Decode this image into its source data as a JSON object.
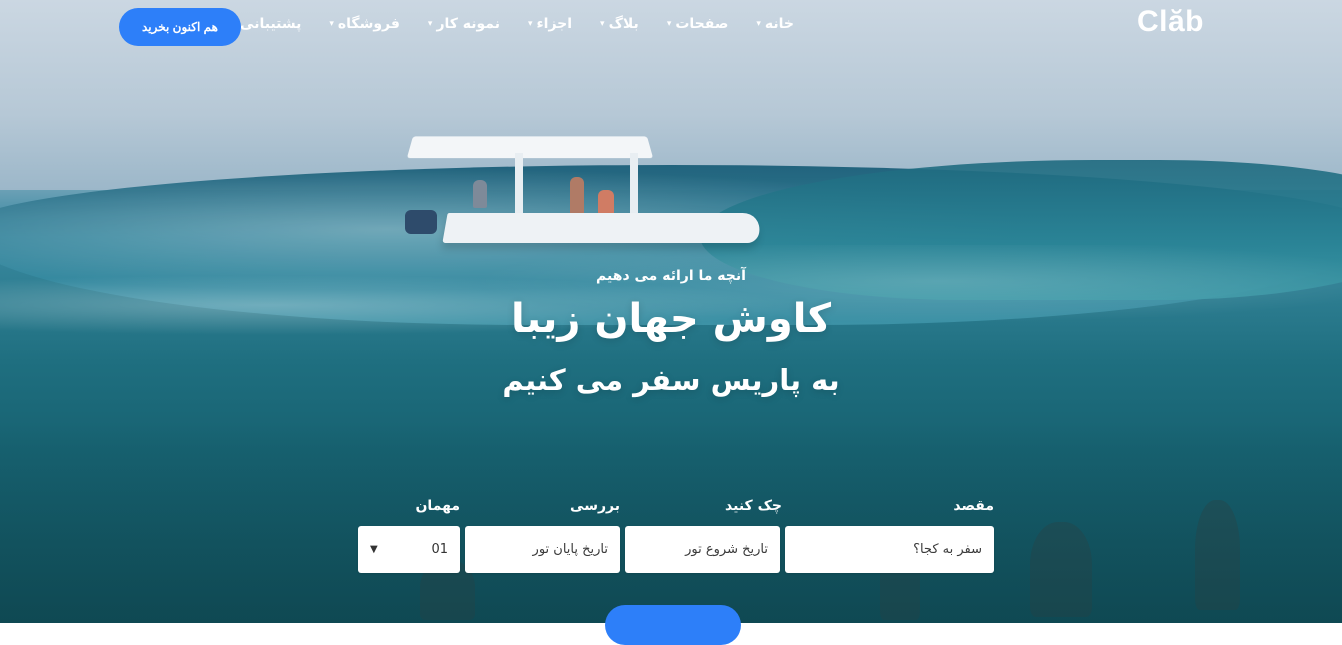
{
  "header": {
    "logo": "Clăb",
    "nav": [
      {
        "label": "خانه"
      },
      {
        "label": "صفحات"
      },
      {
        "label": "بلاگ"
      },
      {
        "label": "اجزاء"
      },
      {
        "label": "نمونه کار"
      },
      {
        "label": "فروشگاه"
      },
      {
        "label": "پشتیبانی"
      }
    ],
    "cta": "هم اکنون بخرید"
  },
  "hero": {
    "eyebrow": "آنچه ما ارائه می دهیم",
    "title": "کاوش جهان زیبا",
    "subtitle": "به پاریس سفر می کنیم"
  },
  "search": {
    "destination": {
      "label": "مقصد",
      "placeholder": "سفر به کجا؟"
    },
    "checkin": {
      "label": "چک کنید",
      "placeholder": "تاریخ شروع تور"
    },
    "checkout": {
      "label": "بررسی",
      "placeholder": "تاریخ پایان تور"
    },
    "guests": {
      "label": "مهمان",
      "value": "01"
    }
  },
  "colors": {
    "accent": "#2d7ff9"
  }
}
